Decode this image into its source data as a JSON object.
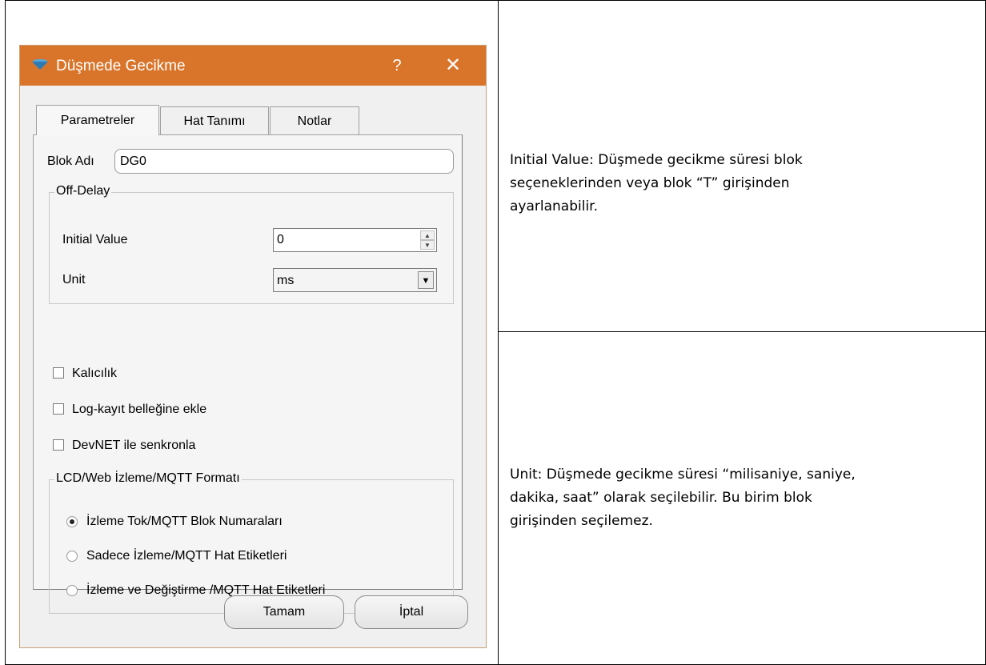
{
  "dialog": {
    "title": "Düşmede Gecikme",
    "help_label": "?",
    "close_label": "✕",
    "tabs": [
      {
        "label": "Parametreler"
      },
      {
        "label": "Hat Tanımı"
      },
      {
        "label": "Notlar"
      }
    ],
    "block_name_label": "Blok Adı",
    "block_name_value": "DG0",
    "off_delay": {
      "title": "Off-Delay",
      "initial_value_label": "Initial Value",
      "initial_value": "0",
      "unit_label": "Unit",
      "unit_value": "ms"
    },
    "checkboxes": [
      {
        "label": "Kalıcılık",
        "checked": false
      },
      {
        "label": "Log-kayıt belleğine ekle",
        "checked": false
      },
      {
        "label": "DevNET ile senkronla",
        "checked": false
      }
    ],
    "format_group": {
      "title": "LCD/Web İzleme/MQTT Formatı",
      "options": [
        {
          "label": "İzleme Tok/MQTT Blok Numaraları",
          "selected": true
        },
        {
          "label": "Sadece İzleme/MQTT Hat Etiketleri",
          "selected": false
        },
        {
          "label": "İzleme ve Değiştirme /MQTT Hat Etiketleri",
          "selected": false
        }
      ]
    },
    "ok_label": "Tamam",
    "cancel_label": "İptal",
    "title_color": "#d9752b"
  },
  "descriptions": {
    "initial_value": [
      "Initial Value:  Düşmede gecikme süresi blok",
      "seçeneklerinden veya blok “T” girişinden",
      "ayarlanabilir."
    ],
    "unit": [
      "Unit:  Düşmede gecikme süresi “milisaniye, saniye,",
      "dakika, saat” olarak seçilebilir. Bu birim blok",
      "girişinden seçilemez."
    ]
  }
}
